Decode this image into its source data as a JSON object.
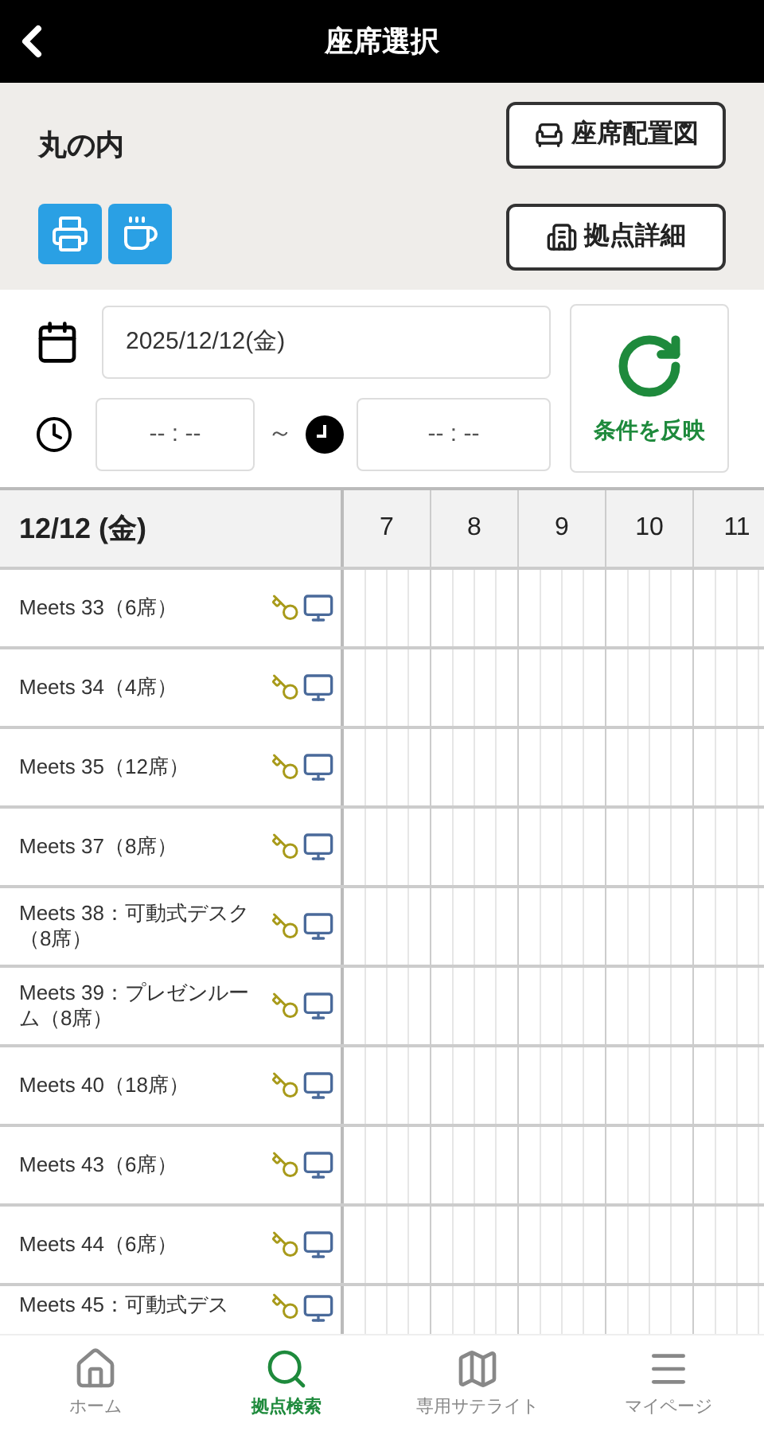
{
  "header": {
    "title": "座席選択"
  },
  "location": {
    "name": "丸の内",
    "buttons": [
      {
        "kind": "seats",
        "label": "座席配置図"
      },
      {
        "kind": "building",
        "label": "拠点詳細"
      }
    ],
    "amenities": [
      {
        "kind": "printer"
      },
      {
        "kind": "drink"
      }
    ]
  },
  "form": {
    "date": "2025/12/12(金)",
    "start_time": "-- : --",
    "separator": "～",
    "end_time": "-- : --",
    "apply_button": "条件を反映"
  },
  "schedule": {
    "date_heading": "12/12 (金)",
    "hours": [
      "7",
      "8",
      "9",
      "10",
      "11"
    ],
    "rooms": [
      {
        "name": "Meets 33（6席）"
      },
      {
        "name": "Meets 34（4席）"
      },
      {
        "name": "Meets 35（12席）"
      },
      {
        "name": "Meets 37（8席）"
      },
      {
        "name": "Meets 38：可動式デスク（8席）"
      },
      {
        "name": "Meets 39：プレゼンルーム（8席）"
      },
      {
        "name": "Meets 40（18席）"
      },
      {
        "name": "Meets 43（6席）"
      },
      {
        "name": "Meets 44（6席）"
      },
      {
        "name": "Meets 45：可動式デス"
      }
    ]
  },
  "nav": [
    {
      "kind": "home",
      "label": "ホーム",
      "selected": false
    },
    {
      "kind": "search",
      "label": "拠点検索",
      "selected": true
    },
    {
      "kind": "map",
      "label": "専用サテライト",
      "selected": false
    },
    {
      "kind": "menu",
      "label": "マイページ",
      "selected": false
    }
  ]
}
